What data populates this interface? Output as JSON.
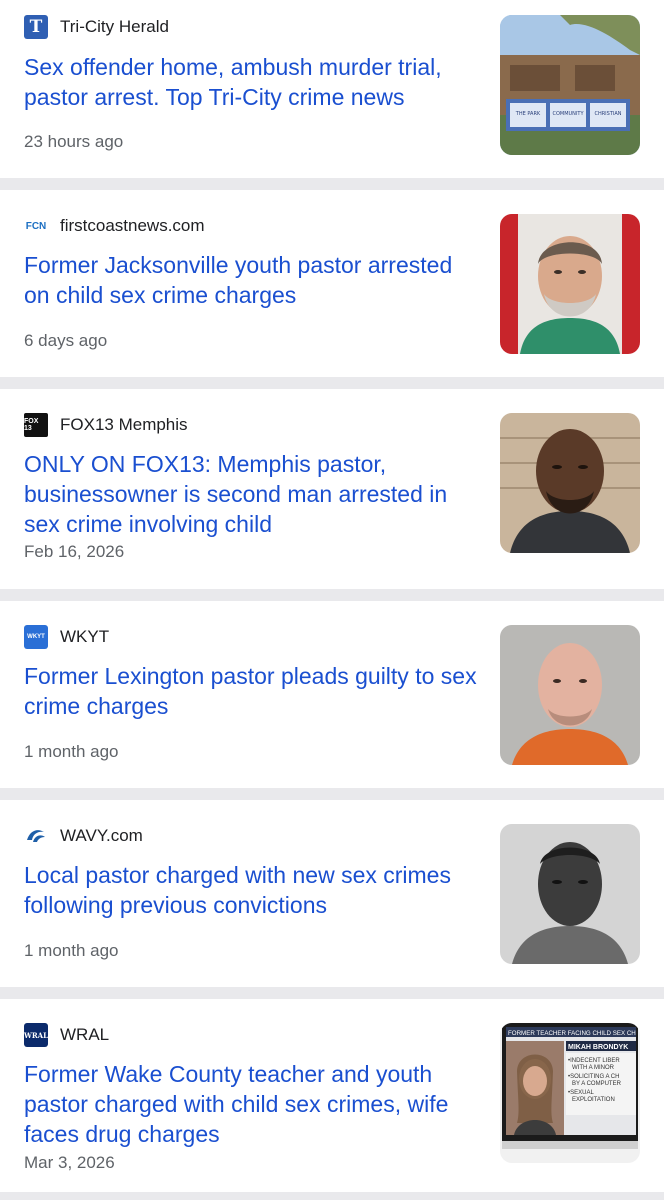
{
  "stories": [
    {
      "source": "Tri-City Herald",
      "headline": "Sex offender home, ambush murder trial, pastor arrest. Top Tri-City crime news",
      "age": "23 hours ago",
      "logo_text": "T",
      "logo_icon": "tri-city-herald-logo-icon",
      "logo_color": "#2f5fb3",
      "thumb_icon": "building-sign-thumbnail"
    },
    {
      "source": "firstcoastnews.com",
      "headline": "Former Jacksonville youth pastor arrested on child sex crime charges",
      "age": "6 days ago",
      "logo_text": "FCN",
      "logo_icon": "first-coast-news-logo-icon",
      "logo_color": "#1c6fc2",
      "thumb_icon": "mugshot-thumbnail"
    },
    {
      "source": "FOX13 Memphis",
      "headline": "ONLY ON FOX13: Memphis pastor, businessowner is second man arrested in sex crime involving child",
      "age": "Feb 16, 2026",
      "logo_text": "FOX 13",
      "logo_icon": "fox13-logo-icon",
      "logo_color": "#111111",
      "thumb_icon": "mugshot-thumbnail"
    },
    {
      "source": "WKYT",
      "headline": "Former Lexington pastor pleads guilty to sex crime charges",
      "age": "1 month ago",
      "logo_text": "WKYT",
      "logo_icon": "wkyt-logo-icon",
      "logo_color": "#2a6fd6",
      "thumb_icon": "mugshot-thumbnail"
    },
    {
      "source": "WAVY.com",
      "headline": "Local pastor charged with new sex crimes following previous convictions",
      "age": "1 month ago",
      "logo_text": "",
      "logo_icon": "wavy-logo-icon",
      "logo_color": "#1f5fa8",
      "thumb_icon": "mugshot-thumbnail"
    },
    {
      "source": "WRAL",
      "headline": "Former Wake County teacher and youth pastor charged with child sex crimes, wife faces drug charges",
      "age": "Mar 3, 2026",
      "logo_text": "WRAL",
      "logo_icon": "wral-logo-icon",
      "logo_color": "#0b2a6b",
      "thumb_icon": "tv-broadcast-thumbnail"
    }
  ],
  "wral_thumb": {
    "banner": "FORMER TEACHER FACING CHILD SEX CH",
    "name": "MIKAH BRONDYK",
    "charges": [
      "•INDECENT LIBER",
      "WITH A MINOR",
      "•SOLICITING A CH",
      "BY A COMPUTER",
      "•SEXUAL",
      "EXPLOITATION"
    ]
  },
  "building_sign": [
    "THE PARK",
    "COMMUNITY",
    "CHRISTIAN"
  ]
}
